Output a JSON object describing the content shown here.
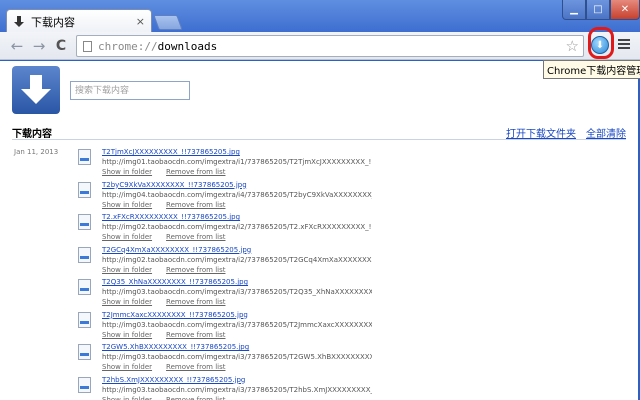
{
  "window": {
    "tab_title": "下载内容",
    "tab_close": "×",
    "min": "▁",
    "max": "□",
    "close": "✕"
  },
  "toolbar": {
    "url_scheme": "chrome://",
    "url_path": "downloads",
    "back": "←",
    "forward": "→",
    "reload": "C",
    "star": "☆",
    "download_button": "⬇"
  },
  "tooltip": "Chrome下载内容管理器",
  "page": {
    "search_placeholder": "搜索下载内容",
    "section_title": "下载内容",
    "open_folder": "打开下载文件夹",
    "clear_all": "全部清除",
    "date": "Jan 11, 2013"
  },
  "actions": {
    "show": "Show in folder",
    "remove": "Remove from list"
  },
  "downloads": [
    {
      "name": "T2TjmXcJXXXXXXXXX_!!737865205.jpg",
      "url": "http://img01.taobaocdn.com/imgextra/i1/737865205/T2TjmXcJXXXXXXXXX_!!7378652"
    },
    {
      "name": "T2byC9XkVaXXXXXXXX_!!737865205.jpg",
      "url": "http://img04.taobaocdn.com/imgextra/i4/737865205/T2byC9XkVaXXXXXXXX_!!7378652"
    },
    {
      "name": "T2.xFXcRXXXXXXXXX_!!737865205.jpg",
      "url": "http://img02.taobaocdn.com/imgextra/i2/737865205/T2.xFXcRXXXXXXXXX_!!7378652"
    },
    {
      "name": "T2GCq4XmXaXXXXXXXX_!!737865205.jpg",
      "url": "http://img02.taobaocdn.com/imgextra/i2/737865205/T2GCq4XmXaXXXXXXXX_!!7378652"
    },
    {
      "name": "T2Q35_XhNaXXXXXXXX_!!737865205.jpg",
      "url": "http://img03.taobaocdn.com/imgextra/i3/737865205/T2Q35_XhNaXXXXXXXX_!!7378652"
    },
    {
      "name": "T2JmmcXaxcXXXXXXXX_!!737865205.jpg",
      "url": "http://img03.taobaocdn.com/imgextra/i3/737865205/T2JmmcXaxcXXXXXXXX_!!7378652"
    },
    {
      "name": "T2GW5.XhBXXXXXXXXX_!!737865205.jpg",
      "url": "http://img03.taobaocdn.com/imgextra/i3/737865205/T2GW5.XhBXXXXXXXXX_!!7378652"
    },
    {
      "name": "T2hbS.XmJXXXXXXXXX_!!737865205.jpg",
      "url": "http://img03.taobaocdn.com/imgextra/i3/737865205/T2hbS.XmJXXXXXXXXX_!!7378652"
    }
  ]
}
